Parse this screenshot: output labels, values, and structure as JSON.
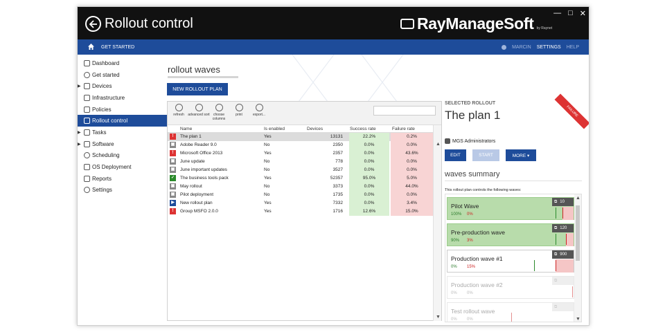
{
  "window": {
    "title": "Rollout control",
    "brand": "RayManageSoft",
    "brand_sub": "by Raynet",
    "controls": [
      "—",
      "□",
      "✕"
    ]
  },
  "navbar": {
    "get_started": "GET STARTED",
    "user": "MARCIN",
    "settings": "SETTINGS",
    "help": "HELP"
  },
  "sidebar": {
    "items": [
      {
        "label": "Dashboard",
        "icon": "dashboard-icon",
        "expandable": false
      },
      {
        "label": "Get started",
        "icon": "info-icon",
        "expandable": false
      },
      {
        "label": "Devices",
        "icon": "devices-icon",
        "expandable": true
      },
      {
        "label": "Infrastructure",
        "icon": "infrastructure-icon",
        "expandable": false
      },
      {
        "label": "Policies",
        "icon": "policies-icon",
        "expandable": false
      },
      {
        "label": "Rollout control",
        "icon": "rollout-icon",
        "expandable": false,
        "active": true
      },
      {
        "label": "Tasks",
        "icon": "tasks-icon",
        "expandable": true
      },
      {
        "label": "Software",
        "icon": "software-icon",
        "expandable": true
      },
      {
        "label": "Scheduling",
        "icon": "clock-icon",
        "expandable": false
      },
      {
        "label": "OS Deployment",
        "icon": "os-icon",
        "expandable": false
      },
      {
        "label": "Reports",
        "icon": "reports-icon",
        "expandable": false
      },
      {
        "label": "Settings",
        "icon": "gear-icon",
        "expandable": false
      }
    ]
  },
  "main": {
    "heading": "rollout waves",
    "new_plan_label": "NEW ROLLOUT PLAN",
    "toolbar": [
      {
        "label": "refresh",
        "icon": "refresh-icon"
      },
      {
        "label": "advanced sort",
        "icon": "sort-icon"
      },
      {
        "label": "choose columns",
        "icon": "columns-icon"
      },
      {
        "label": "print",
        "icon": "print-icon"
      },
      {
        "label": "export...",
        "icon": "export-icon"
      }
    ],
    "columns": [
      "Name",
      "Is enabled",
      "Devices",
      "Success rate",
      "Failure rate"
    ],
    "rows": [
      {
        "status": "error",
        "name": "The plan 1",
        "enabled": "Yes",
        "devices": "13131",
        "success": "22.2%",
        "failure": "0.2%"
      },
      {
        "status": "pending",
        "name": "Adobe Reader 9.0",
        "enabled": "No",
        "devices": "2350",
        "success": "0.0%",
        "failure": "0.0%"
      },
      {
        "status": "error",
        "name": "Microsoft Office 2013",
        "enabled": "Yes",
        "devices": "2357",
        "success": "0.0%",
        "failure": "43.6%"
      },
      {
        "status": "pending",
        "name": "June update",
        "enabled": "No",
        "devices": "778",
        "success": "0.0%",
        "failure": "0.0%"
      },
      {
        "status": "pending",
        "name": "June important updates",
        "enabled": "No",
        "devices": "3527",
        "success": "0.0%",
        "failure": "0.0%"
      },
      {
        "status": "success",
        "name": "The business tools pack",
        "enabled": "Yes",
        "devices": "52357",
        "success": "95.0%",
        "failure": "5.0%"
      },
      {
        "status": "pending",
        "name": "May rollout",
        "enabled": "No",
        "devices": "3373",
        "success": "0.0%",
        "failure": "44.0%"
      },
      {
        "status": "pending",
        "name": "Pilot deployment",
        "enabled": "No",
        "devices": "1735",
        "success": "0.0%",
        "failure": "0.0%"
      },
      {
        "status": "running",
        "name": "New rollout plan",
        "enabled": "Yes",
        "devices": "7332",
        "success": "0.0%",
        "failure": "3.4%"
      },
      {
        "status": "error",
        "name": "Group MSFO 2.0.0",
        "enabled": "Yes",
        "devices": "1716",
        "success": "12.6%",
        "failure": "15.0%"
      }
    ]
  },
  "detail": {
    "label": "SELECTED ROLLOUT",
    "title": "The plan 1",
    "ribbon": "FAILURE",
    "owner": "MGS Administrators",
    "buttons": {
      "edit": "EDIT",
      "start": "START",
      "more": "MORE ▾"
    },
    "waves_heading": "waves summary",
    "waves_desc": "This rollout plan controls the following waves:",
    "waves": [
      {
        "name": "Pilot Wave",
        "success": "100%",
        "failure": "0%",
        "count": "10",
        "state": "green",
        "success_marker": 0.85,
        "failure_marker": 0.9
      },
      {
        "name": "Pre-production wave",
        "success": "90%",
        "failure": "3%",
        "count": "120",
        "state": "green",
        "success_marker": 0.85,
        "failure_marker": 0.93
      },
      {
        "name": "Production wave #1",
        "success": "0%",
        "failure": "15%",
        "count": "900",
        "state": "white",
        "success_marker": 0.68,
        "failure_marker": 0.85
      },
      {
        "name": "Production wave #2",
        "success": "0%",
        "failure": "0%",
        "count": "",
        "state": "faded",
        "success_marker": 0.0,
        "failure_marker": 0.98
      },
      {
        "name": "Test rollout wave",
        "success": "0%",
        "failure": "0%",
        "count": "",
        "state": "faded",
        "success_marker": 0.0,
        "failure_marker": 0.5
      }
    ]
  },
  "colors": {
    "titlebar": "#111111",
    "accent": "#1e4c9a",
    "success_bg": "#d9f0d3",
    "failure_bg": "#f8d4d4",
    "error": "#dd3333",
    "ok": "#2b8a2b",
    "running": "#1e4c9a",
    "pending": "#888888"
  }
}
